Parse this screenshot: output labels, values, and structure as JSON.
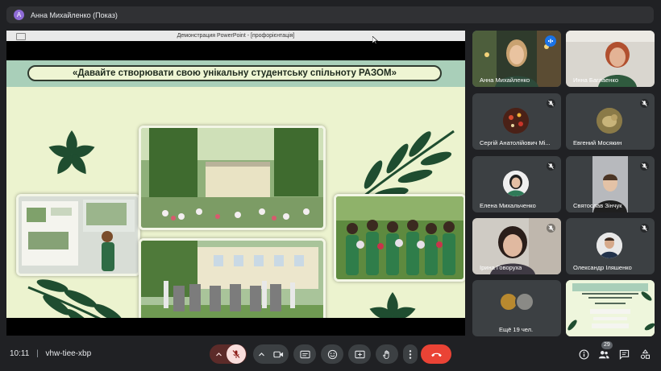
{
  "presenter_bar": {
    "avatar_letter": "А",
    "title": "Анна Михайленко (Показ)"
  },
  "presentation": {
    "window_title": "Демонстрация PowerPoint - [профорієнтація]",
    "slide_title": "«Давайте створювати свою унікальну студентську спільноту РАЗОМ»"
  },
  "participants": [
    {
      "name": "Анна Михайленко",
      "state": "speaking",
      "active": true
    },
    {
      "name": "Инна Баглаенко",
      "state": "none"
    },
    {
      "name": "Сергій Анатолійович Мі...",
      "state": "muted"
    },
    {
      "name": "Евгений Мосякин",
      "state": "muted"
    },
    {
      "name": "Елена Михальченко",
      "state": "muted"
    },
    {
      "name": "Святослав Зінчук",
      "state": "muted"
    },
    {
      "name": "Ірина Говоруха",
      "state": "muted"
    },
    {
      "name": "Олександр Іляшенко",
      "state": "muted"
    }
  ],
  "others_tile": {
    "label": "Ещё 19 чел."
  },
  "bottom": {
    "time": "10:11",
    "separator": "|",
    "meeting_code": "vhw-tiee-xbp",
    "participant_count": "29"
  },
  "colors": {
    "background": "#202124",
    "tile": "#3c4043",
    "hangup": "#ea4335",
    "mic_off": "#f9dedc",
    "accent": "#1a73e8",
    "slide_bg": "#ecf3cf",
    "banner": "#a9cfb9",
    "leaf": "#1f4d30"
  }
}
